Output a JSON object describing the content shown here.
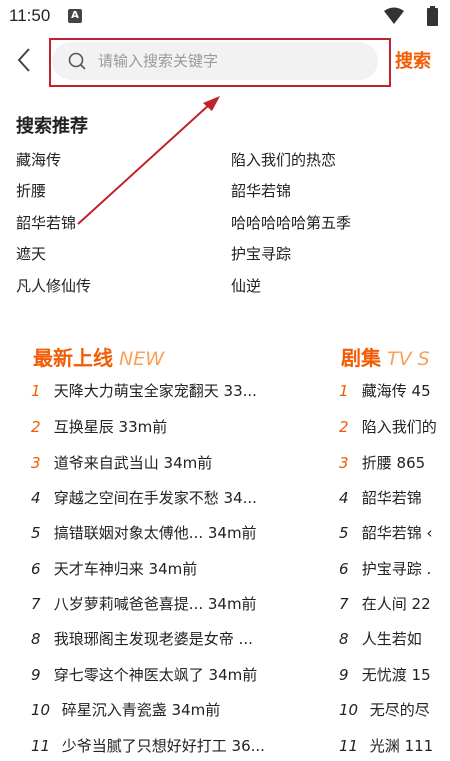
{
  "status_bar": {
    "time": "11:50",
    "notification_icon": "A"
  },
  "header": {
    "search_placeholder": "请输入搜索关键字",
    "search_button": "搜索"
  },
  "recommend": {
    "title": "搜索推荐",
    "left": [
      "藏海传",
      "折腰",
      "韶华若锦",
      "遮天",
      "凡人修仙传"
    ],
    "right": [
      "陷入我们的热恋",
      "韶华若锦",
      "哈哈哈哈哈第五季",
      "护宝寻踪",
      "仙逆"
    ]
  },
  "latest": {
    "title": "最新上线",
    "title_en": "NEW",
    "items": [
      {
        "rank": "1",
        "text": "天降大力萌宝全家宠翻天 33..."
      },
      {
        "rank": "2",
        "text": "互换星辰 33m前"
      },
      {
        "rank": "3",
        "text": "道爷来自武当山 34m前"
      },
      {
        "rank": "4",
        "text": "穿越之空间在手发家不愁 34..."
      },
      {
        "rank": "5",
        "text": "搞错联姻对象太傅他... 34m前"
      },
      {
        "rank": "6",
        "text": "天才车神归来 34m前"
      },
      {
        "rank": "7",
        "text": "八岁萝莉喊爸爸喜提... 34m前"
      },
      {
        "rank": "8",
        "text": "我琅琊阁主发现老婆是女帝 ..."
      },
      {
        "rank": "9",
        "text": "穿七零这个神医太飒了 34m前"
      },
      {
        "rank": "10",
        "text": "碎星沉入青瓷盏 34m前"
      },
      {
        "rank": "11",
        "text": "少爷当腻了只想好好打工 36..."
      }
    ]
  },
  "drama": {
    "title": "剧集",
    "title_en": "TV S",
    "items": [
      {
        "rank": "1",
        "text": "藏海传 45"
      },
      {
        "rank": "2",
        "text": "陷入我们的"
      },
      {
        "rank": "3",
        "text": "折腰 865"
      },
      {
        "rank": "4",
        "text": "韶华若锦"
      },
      {
        "rank": "5",
        "text": "韶华若锦 ‹"
      },
      {
        "rank": "6",
        "text": "护宝寻踪 ."
      },
      {
        "rank": "7",
        "text": "在人间 22"
      },
      {
        "rank": "8",
        "text": "人生若如"
      },
      {
        "rank": "9",
        "text": "无忧渡 15"
      },
      {
        "rank": "10",
        "text": "无尽的尽"
      },
      {
        "rank": "11",
        "text": "光渊 111"
      }
    ]
  },
  "colors": {
    "accent": "#f25c05",
    "accent_light": "#f9a15b",
    "annotation": "#c0212a"
  }
}
